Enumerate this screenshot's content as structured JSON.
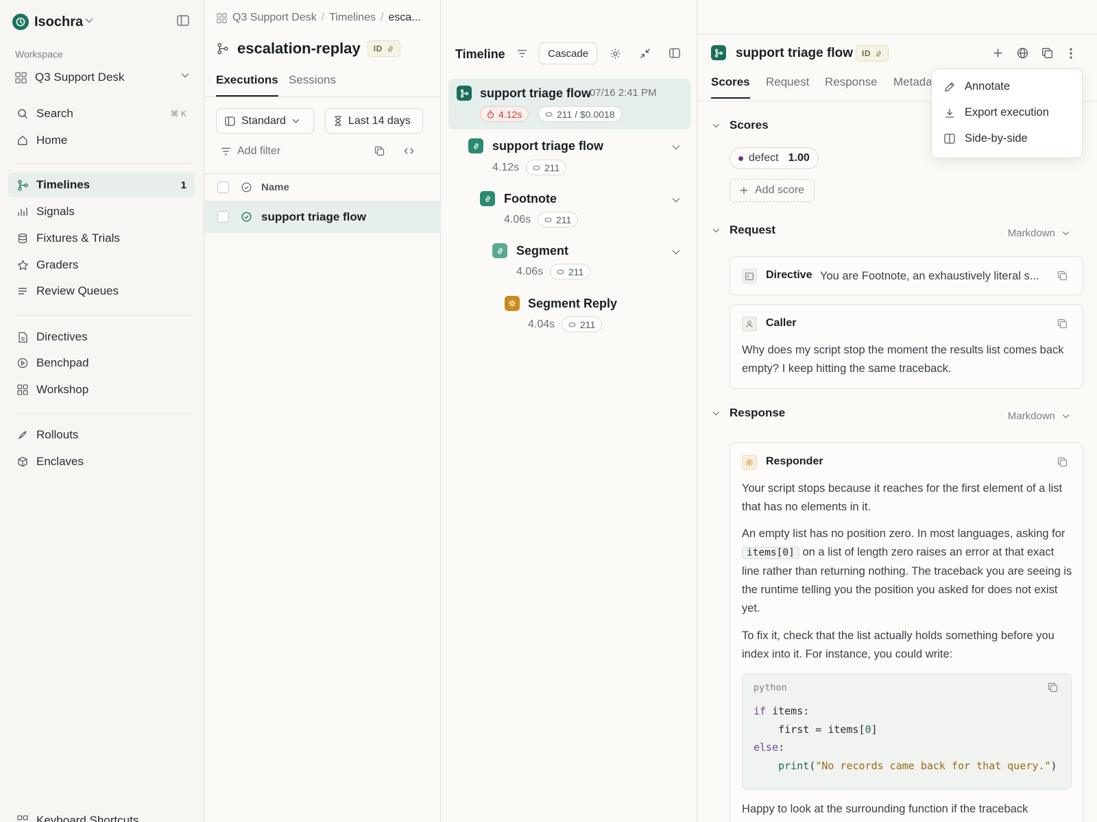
{
  "app": {
    "name": "Isochra",
    "workspace_label": "Workspace",
    "workspace": "Q3 Support Desk",
    "search_label": "Search",
    "search_shortcut": "⌘ K",
    "nav": {
      "home": "Home",
      "timelines": "Timelines",
      "timelines_count": "1",
      "signals": "Signals",
      "fixtures": "Fixtures & Trials",
      "graders": "Graders",
      "review_queues": "Review Queues",
      "directives": "Directives",
      "benchpad": "Benchpad",
      "workshop": "Workshop",
      "rollouts": "Rollouts",
      "enclaves": "Enclaves",
      "keyboard_shortcuts": "Keyboard Shortcuts"
    }
  },
  "list": {
    "breadcrumb": [
      "Q3 Support Desk",
      "Timelines",
      "esca..."
    ],
    "title": "escalation-replay",
    "id_chip": "ID",
    "tabs": [
      "Executions",
      "Sessions"
    ],
    "view_select": "Standard",
    "range_select": "Last 14 days",
    "add_filter": "Add filter",
    "col_name": "Name",
    "rows": [
      {
        "name": "support triage flow"
      }
    ]
  },
  "timeline": {
    "title": "Timeline",
    "mode": "Cascade",
    "root": {
      "name": "support triage flow",
      "timestamp": "07/16 2:41 PM",
      "duration": "4.12s",
      "tokens_cost": "211 / $0.0018"
    },
    "nodes": [
      {
        "name": "support triage flow",
        "duration": "4.12s",
        "tokens": "211"
      },
      {
        "name": "Footnote",
        "duration": "4.06s",
        "tokens": "211"
      },
      {
        "name": "Segment",
        "duration": "4.06s",
        "tokens": "211"
      },
      {
        "name": "Segment Reply",
        "duration": "4.04s",
        "tokens": "211"
      }
    ]
  },
  "detail": {
    "title": "support triage flow",
    "id_chip": "ID",
    "tabs": [
      "Scores",
      "Request",
      "Response",
      "Metada"
    ],
    "scores_title": "Scores",
    "score_name": "defect",
    "score_value": "1.00",
    "add_score": "Add score",
    "request_title": "Request",
    "request_format": "Markdown",
    "directive_role": "Directive",
    "directive_preview": "You are Footnote, an exhaustively literal s...",
    "caller_role": "Caller",
    "caller_text": "Why does my script stop the moment the results list comes back empty? I keep hitting the same traceback.",
    "response_title": "Response",
    "response_format": "Markdown",
    "responder_role": "Responder",
    "resp_p1": "Your script stops because it reaches for the first element of a list that has no elements in it.",
    "resp_p2_a": "An empty list has no position zero. In most languages, asking for",
    "resp_p2_code": "items[0]",
    "resp_p2_b": "on a list of length zero raises an error at that exact line rather than returning nothing. The traceback you are seeing is the runtime telling you the position you asked for does not exist yet.",
    "resp_p3": "To fix it, check that the list actually holds something before you index into it. For instance, you could write:",
    "code_lang": "python",
    "code": {
      "l1_kw": "if",
      "l1_rest": " items:",
      "l2_a": "    first = items[",
      "l2_num": "0",
      "l2_b": "]",
      "l3_kw": "else",
      "l3_rest": ":",
      "l4_fn": "    print",
      "l4_a": "(",
      "l4_str": "\"No records came back for that query.\"",
      "l4_b": ")"
    },
    "resp_p4": "Happy to look at the surrounding function if the traceback"
  },
  "menu": {
    "annotate": "Annotate",
    "export": "Export execution",
    "side_by_side": "Side-by-side"
  },
  "colors": {
    "accent_green": "#1a7560",
    "row_highlight": "#e6efec",
    "duration_alert": "#c2413b",
    "reply_icon": "#c98a1b"
  }
}
